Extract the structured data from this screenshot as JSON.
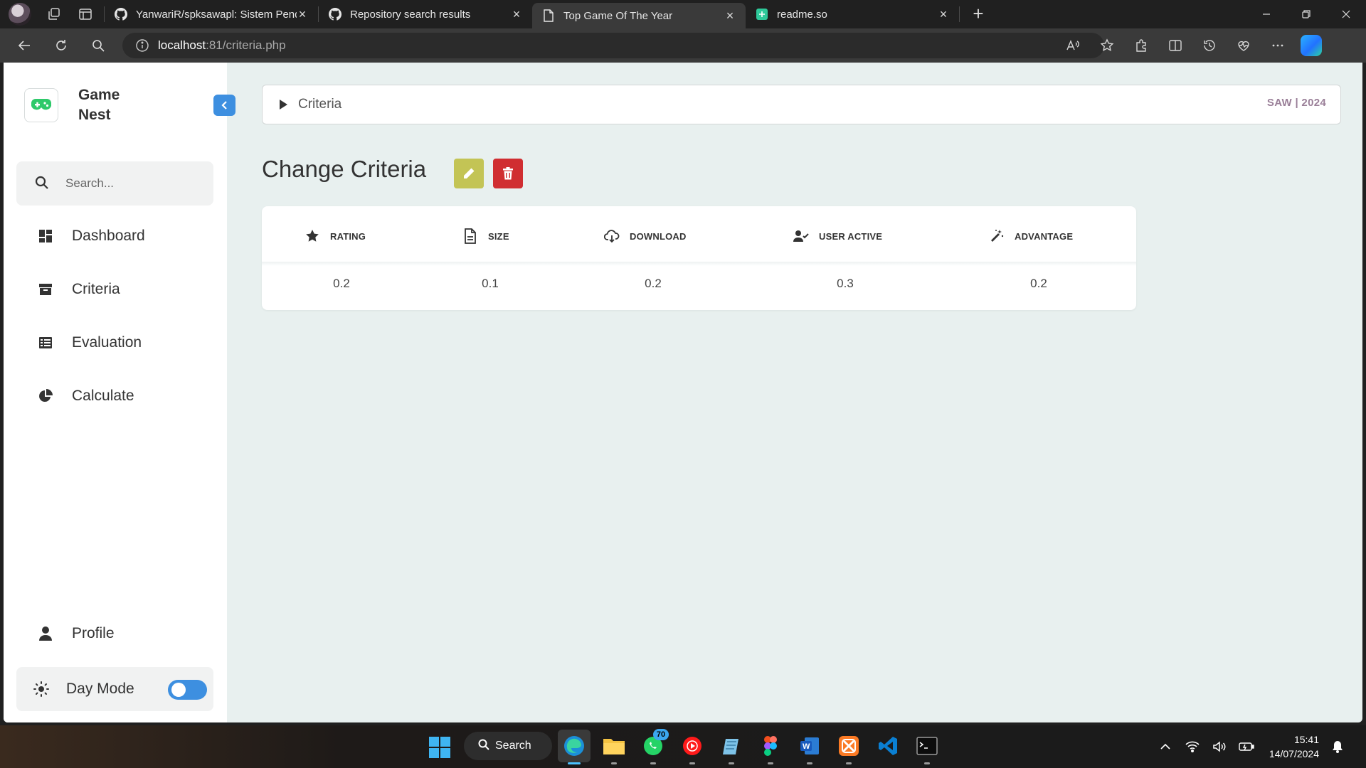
{
  "browser": {
    "tabs": [
      {
        "title": "YanwariR/spksawapl: Sistem Pend",
        "favicon": "github-icon"
      },
      {
        "title": "Repository search results",
        "favicon": "github-icon"
      },
      {
        "title": "Top Game Of The Year",
        "favicon": "page-icon",
        "active": true
      },
      {
        "title": "readme.so",
        "favicon": "readme-icon"
      }
    ],
    "url_host": "localhost",
    "url_path": ":81/criteria.php"
  },
  "sidebar": {
    "brand_line1": "Game",
    "brand_line2": "Nest",
    "search_placeholder": "Search...",
    "nav": [
      {
        "label": "Dashboard",
        "icon": "dashboard-icon"
      },
      {
        "label": "Criteria",
        "icon": "archive-icon"
      },
      {
        "label": "Evaluation",
        "icon": "list-icon"
      },
      {
        "label": "Calculate",
        "icon": "pie-chart-icon"
      }
    ],
    "profile_label": "Profile",
    "day_mode_label": "Day Mode"
  },
  "breadcrumb": {
    "label": "Criteria",
    "right_text": "SAW | 2024"
  },
  "page": {
    "title": "Change Criteria"
  },
  "table": {
    "columns": [
      {
        "label": "RATING",
        "icon": "star-icon"
      },
      {
        "label": "SIZE",
        "icon": "file-icon"
      },
      {
        "label": "DOWNLOAD",
        "icon": "cloud-download-icon"
      },
      {
        "label": "USER ACTIVE",
        "icon": "user-check-icon"
      },
      {
        "label": "ADVANTAGE",
        "icon": "magic-wand-icon"
      }
    ],
    "row": [
      "0.2",
      "0.1",
      "0.2",
      "0.3",
      "0.2"
    ]
  },
  "taskbar": {
    "search_label": "Search",
    "whatsapp_badge": "70",
    "time": "15:41",
    "date": "14/07/2024"
  },
  "colors": {
    "accent": "#3d8fe0",
    "edit_button": "#c3c455",
    "delete_button": "#d02e31",
    "page_background": "#e8f0ef",
    "logo_green": "#2ec96a"
  }
}
